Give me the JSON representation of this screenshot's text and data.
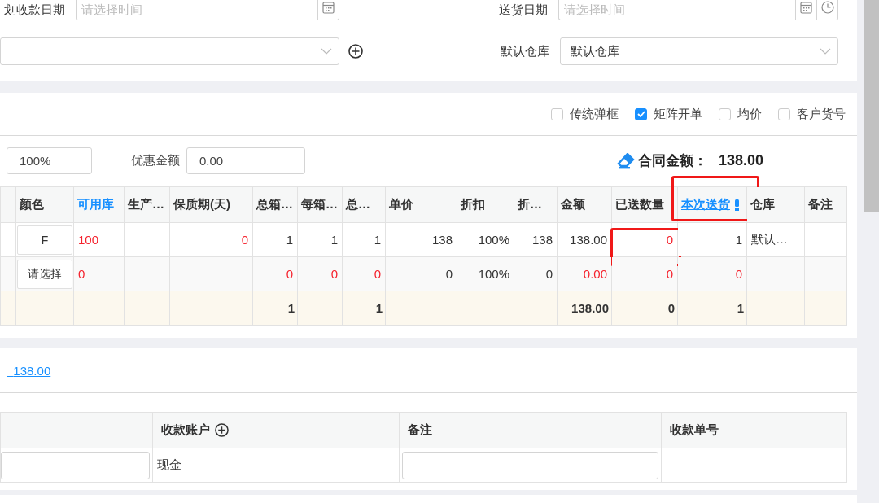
{
  "header_form": {
    "payment_date": {
      "label": "划收款日期",
      "placeholder": "请选择时间"
    },
    "delivery_date": {
      "label": "送货日期",
      "placeholder": "请选择时间"
    },
    "warehouse": {
      "label": "默认仓库",
      "value": "默认仓库"
    }
  },
  "options": [
    {
      "label": "传统弹框",
      "checked": false
    },
    {
      "label": "矩阵开单",
      "checked": true
    },
    {
      "label": "均价",
      "checked": false
    },
    {
      "label": "客户货号",
      "checked": false
    }
  ],
  "discount": {
    "rate": "100%",
    "label": "优惠金额",
    "value": "0.00"
  },
  "contract_amount": {
    "label": "合同金额：",
    "value": "138.00"
  },
  "items_table": {
    "columns": [
      {
        "label": "颜色",
        "kind": "plain",
        "annotated": false
      },
      {
        "label": "可用库",
        "kind": "accent",
        "annotated": false
      },
      {
        "label": "生产…",
        "kind": "plain",
        "annotated": false
      },
      {
        "label": "保质期(天)",
        "kind": "plain",
        "annotated": false
      },
      {
        "label": "总箱…",
        "kind": "plain",
        "annotated": false,
        "total": "1"
      },
      {
        "label": "每箱…",
        "kind": "plain",
        "annotated": false
      },
      {
        "label": "总…",
        "kind": "plain",
        "annotated": false,
        "total": "1"
      },
      {
        "label": "单价",
        "kind": "plain",
        "annotated": false
      },
      {
        "label": "折扣",
        "kind": "plain",
        "annotated": false
      },
      {
        "label": "折…",
        "kind": "plain",
        "annotated": false
      },
      {
        "label": "金额",
        "kind": "plain",
        "annotated": false,
        "total": "138.00"
      },
      {
        "label": "已送数量",
        "kind": "plain",
        "annotated": false,
        "total": "0"
      },
      {
        "label": "本次送货",
        "kind": "link",
        "annotated": true,
        "total": "1"
      },
      {
        "label": "仓库",
        "kind": "plain",
        "annotated": false
      },
      {
        "label": "备注",
        "kind": "plain",
        "annotated": false
      }
    ],
    "rows": [
      {
        "cells": [
          {
            "text": "F",
            "kind": "picker",
            "annotated": false
          },
          {
            "text": "100",
            "kind": "text",
            "alert": true,
            "annotated": false
          },
          {
            "kind": "empty"
          },
          {
            "text": "0",
            "kind": "text",
            "alert": true,
            "annotated": false
          },
          {
            "text": "1",
            "kind": "text",
            "alert": false,
            "annotated": false
          },
          {
            "text": "1",
            "kind": "text",
            "alert": false,
            "annotated": false
          },
          {
            "text": "1",
            "kind": "text",
            "alert": false,
            "annotated": false
          },
          {
            "text": "138",
            "kind": "text",
            "alert": false,
            "annotated": false
          },
          {
            "text": "100%",
            "kind": "text",
            "alert": false,
            "annotated": false
          },
          {
            "text": "138",
            "kind": "text",
            "alert": false,
            "annotated": false
          },
          {
            "text": "138.00",
            "kind": "text",
            "alert": false,
            "annotated": false
          },
          {
            "text": "0",
            "kind": "text",
            "alert": true,
            "annotated": true
          },
          {
            "text": "1",
            "kind": "text",
            "alert": false,
            "annotated": false
          },
          {
            "text": "默认…",
            "kind": "text",
            "alert": false,
            "annotated": false
          },
          {
            "kind": "empty"
          }
        ]
      },
      {
        "cells": [
          {
            "text": "请选择",
            "kind": "picker",
            "annotated": false
          },
          {
            "text": "0",
            "kind": "text",
            "alert": true,
            "annotated": false
          },
          {
            "kind": "empty"
          },
          {
            "kind": "empty"
          },
          {
            "text": "0",
            "kind": "text",
            "alert": true,
            "annotated": false
          },
          {
            "text": "0",
            "kind": "text",
            "alert": true,
            "annotated": false
          },
          {
            "text": "0",
            "kind": "text",
            "alert": true,
            "annotated": false
          },
          {
            "text": "0",
            "kind": "text",
            "alert": false,
            "annotated": false
          },
          {
            "text": "100%",
            "kind": "text",
            "alert": false,
            "annotated": false
          },
          {
            "text": "0",
            "kind": "text",
            "alert": false,
            "annotated": false
          },
          {
            "text": "0.00",
            "kind": "text",
            "alert": true,
            "annotated": false
          },
          {
            "text": "0",
            "kind": "text",
            "alert": true,
            "annotated": false
          },
          {
            "text": "0",
            "kind": "text",
            "alert": true,
            "annotated": false
          },
          {
            "kind": "empty"
          },
          {
            "kind": "empty"
          }
        ]
      }
    ]
  },
  "paid_amount": "138.00",
  "payment_table": {
    "columns": [
      "收款账户",
      "备注",
      "收款单号"
    ],
    "rows": [
      {
        "account": "现金"
      }
    ]
  }
}
